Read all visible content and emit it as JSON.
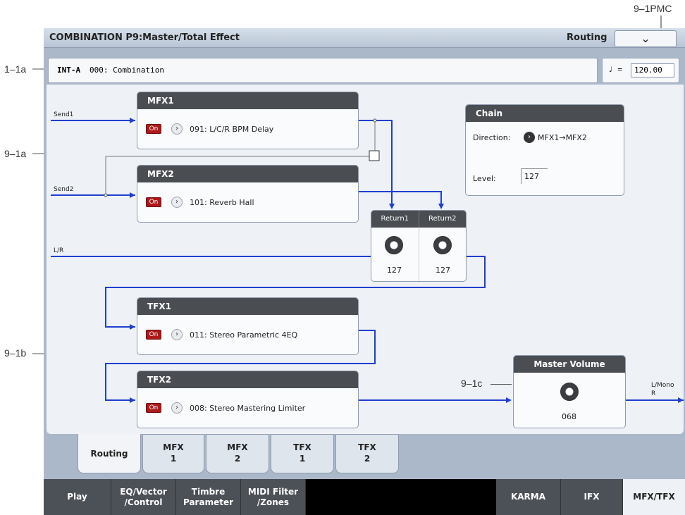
{
  "callouts": {
    "pmc": "9–1PMC",
    "c1a": "1–1a",
    "c91a": "9–1a",
    "c91b": "9–1b",
    "c91c": "9–1c"
  },
  "header": {
    "title": "COMBINATION P9:Master/Total Effect",
    "page": "Routing",
    "menu_glyph": "⌄"
  },
  "info": {
    "bank": "INT-A",
    "program": "000: Combination",
    "tempo_symbol": "♩ =",
    "tempo": "120.00"
  },
  "signals": {
    "send1": "Send1",
    "send2": "Send2",
    "lr": "L/R",
    "out1": "L/Mono",
    "out2": "R"
  },
  "mfx1": {
    "title": "MFX1",
    "on": "On",
    "effect": "091: L/C/R BPM Delay"
  },
  "mfx2": {
    "title": "MFX2",
    "on": "On",
    "effect": "101: Reverb Hall"
  },
  "tfx1": {
    "title": "TFX1",
    "on": "On",
    "effect": "011: Stereo Parametric 4EQ"
  },
  "tfx2": {
    "title": "TFX2",
    "on": "On",
    "effect": "008: Stereo Mastering Limiter"
  },
  "chain": {
    "title": "Chain",
    "direction_label": "Direction:",
    "direction_value": "MFX1→MFX2",
    "level_label": "Level:",
    "level_value": "127"
  },
  "returns": {
    "return1_label": "Return1",
    "return2_label": "Return2",
    "return1_value": "127",
    "return2_value": "127"
  },
  "master": {
    "title": "Master Volume",
    "value": "068"
  },
  "tabs": {
    "routing": "Routing",
    "mfx1": [
      "MFX",
      "1"
    ],
    "mfx2": [
      "MFX",
      "2"
    ],
    "tfx1": [
      "TFX",
      "1"
    ],
    "tfx2": [
      "TFX",
      "2"
    ]
  },
  "bottom_tabs": {
    "play": "Play",
    "eq": [
      "EQ/Vector",
      "/Control"
    ],
    "timbre": [
      "Timbre",
      "Parameter"
    ],
    "midi": [
      "MIDI Filter",
      "/Zones"
    ],
    "karma": "KARMA",
    "ifx": "IFX",
    "mfxtfx": "MFX/TFX"
  },
  "colors": {
    "signal": "#1f3fd0",
    "header": "#4a4d52",
    "on": "#b01818"
  }
}
